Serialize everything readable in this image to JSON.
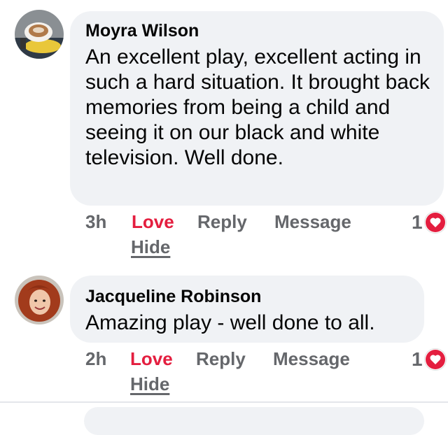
{
  "comments": [
    {
      "author": "Moyra Wilson",
      "text": "An excellent play, excellent acting in such a hard situation. It brought back memories from being a child and seeing it on our black and white television. Well done.",
      "time": "3h",
      "love_label": "Love",
      "reply_label": "Reply",
      "message_label": "Message",
      "hide_label": "Hide",
      "reaction_count": "1",
      "reaction_icon": "heart-icon"
    },
    {
      "author": "Jacqueline Robinson",
      "text": "Amazing play - well done to all.",
      "time": "2h",
      "love_label": "Love",
      "reply_label": "Reply",
      "message_label": "Message",
      "hide_label": "Hide",
      "reaction_count": "1",
      "reaction_icon": "heart-icon"
    }
  ],
  "colors": {
    "bubble": "#f0f2f5",
    "love": "#e41e3f",
    "muted": "#65676b",
    "text": "#050505"
  }
}
